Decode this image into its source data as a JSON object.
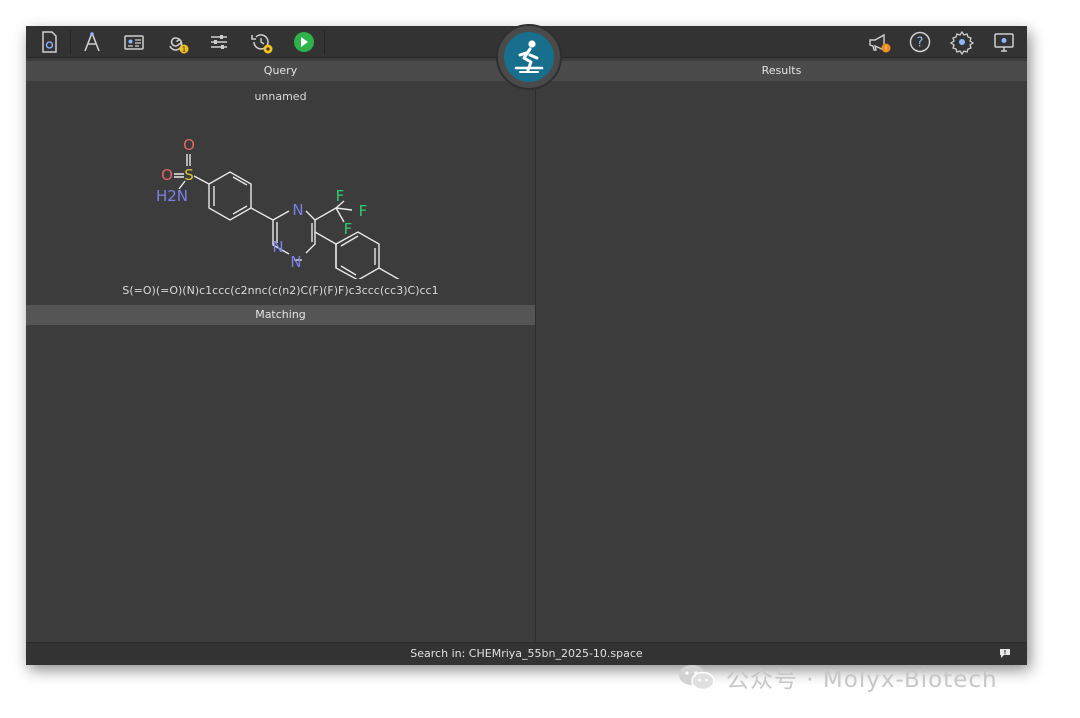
{
  "toolbar": {
    "left_buttons": [
      {
        "icon": "document-icon"
      },
      {
        "icon": "compass-icon"
      },
      {
        "icon": "id-card-icon"
      },
      {
        "icon": "spiral-icon",
        "badge": "1"
      },
      {
        "icon": "sliders-icon"
      },
      {
        "icon": "history-icon",
        "badge": ""
      },
      {
        "icon": "play-icon"
      }
    ],
    "right_buttons": [
      {
        "icon": "megaphone-icon",
        "badge": "!"
      },
      {
        "icon": "help-icon",
        "glyph": "?"
      },
      {
        "icon": "gear-icon"
      },
      {
        "icon": "monitor-icon"
      }
    ],
    "logo_icon": "runner-logo-icon"
  },
  "query": {
    "header": "Query",
    "molecule_name": "unnamed",
    "smiles": "S(=O)(=O)(N)c1ccc(c2nnc(c(n2)C(F)(F)F)c3ccc(cc3)C)cc1",
    "atom_labels": {
      "oxygen": "O",
      "sulfur": "S",
      "amine": "H2N",
      "nitrogen": "N",
      "fluorine": "F"
    }
  },
  "matching": {
    "header": "Matching"
  },
  "results": {
    "header": "Results"
  },
  "status": {
    "text": "Search in: CHEMriya_55bn_2025-10.space",
    "icon": "comment-icon"
  },
  "watermark": {
    "icon": "wechat-icon",
    "text": "公众号 · Molyx-Biotech"
  },
  "colors": {
    "background": "#3c3c3c",
    "toolbar": "#333333",
    "header": "#4b4b4b",
    "logo": "#176f8d",
    "play": "#2fb24a",
    "badge_yellow": "#f2c21b",
    "badge_orange": "#f08a1c",
    "oxygen": "#e06666",
    "sulfur": "#d8c23a",
    "nitrogen": "#7d7fe8",
    "fluorine": "#2ecc71"
  }
}
